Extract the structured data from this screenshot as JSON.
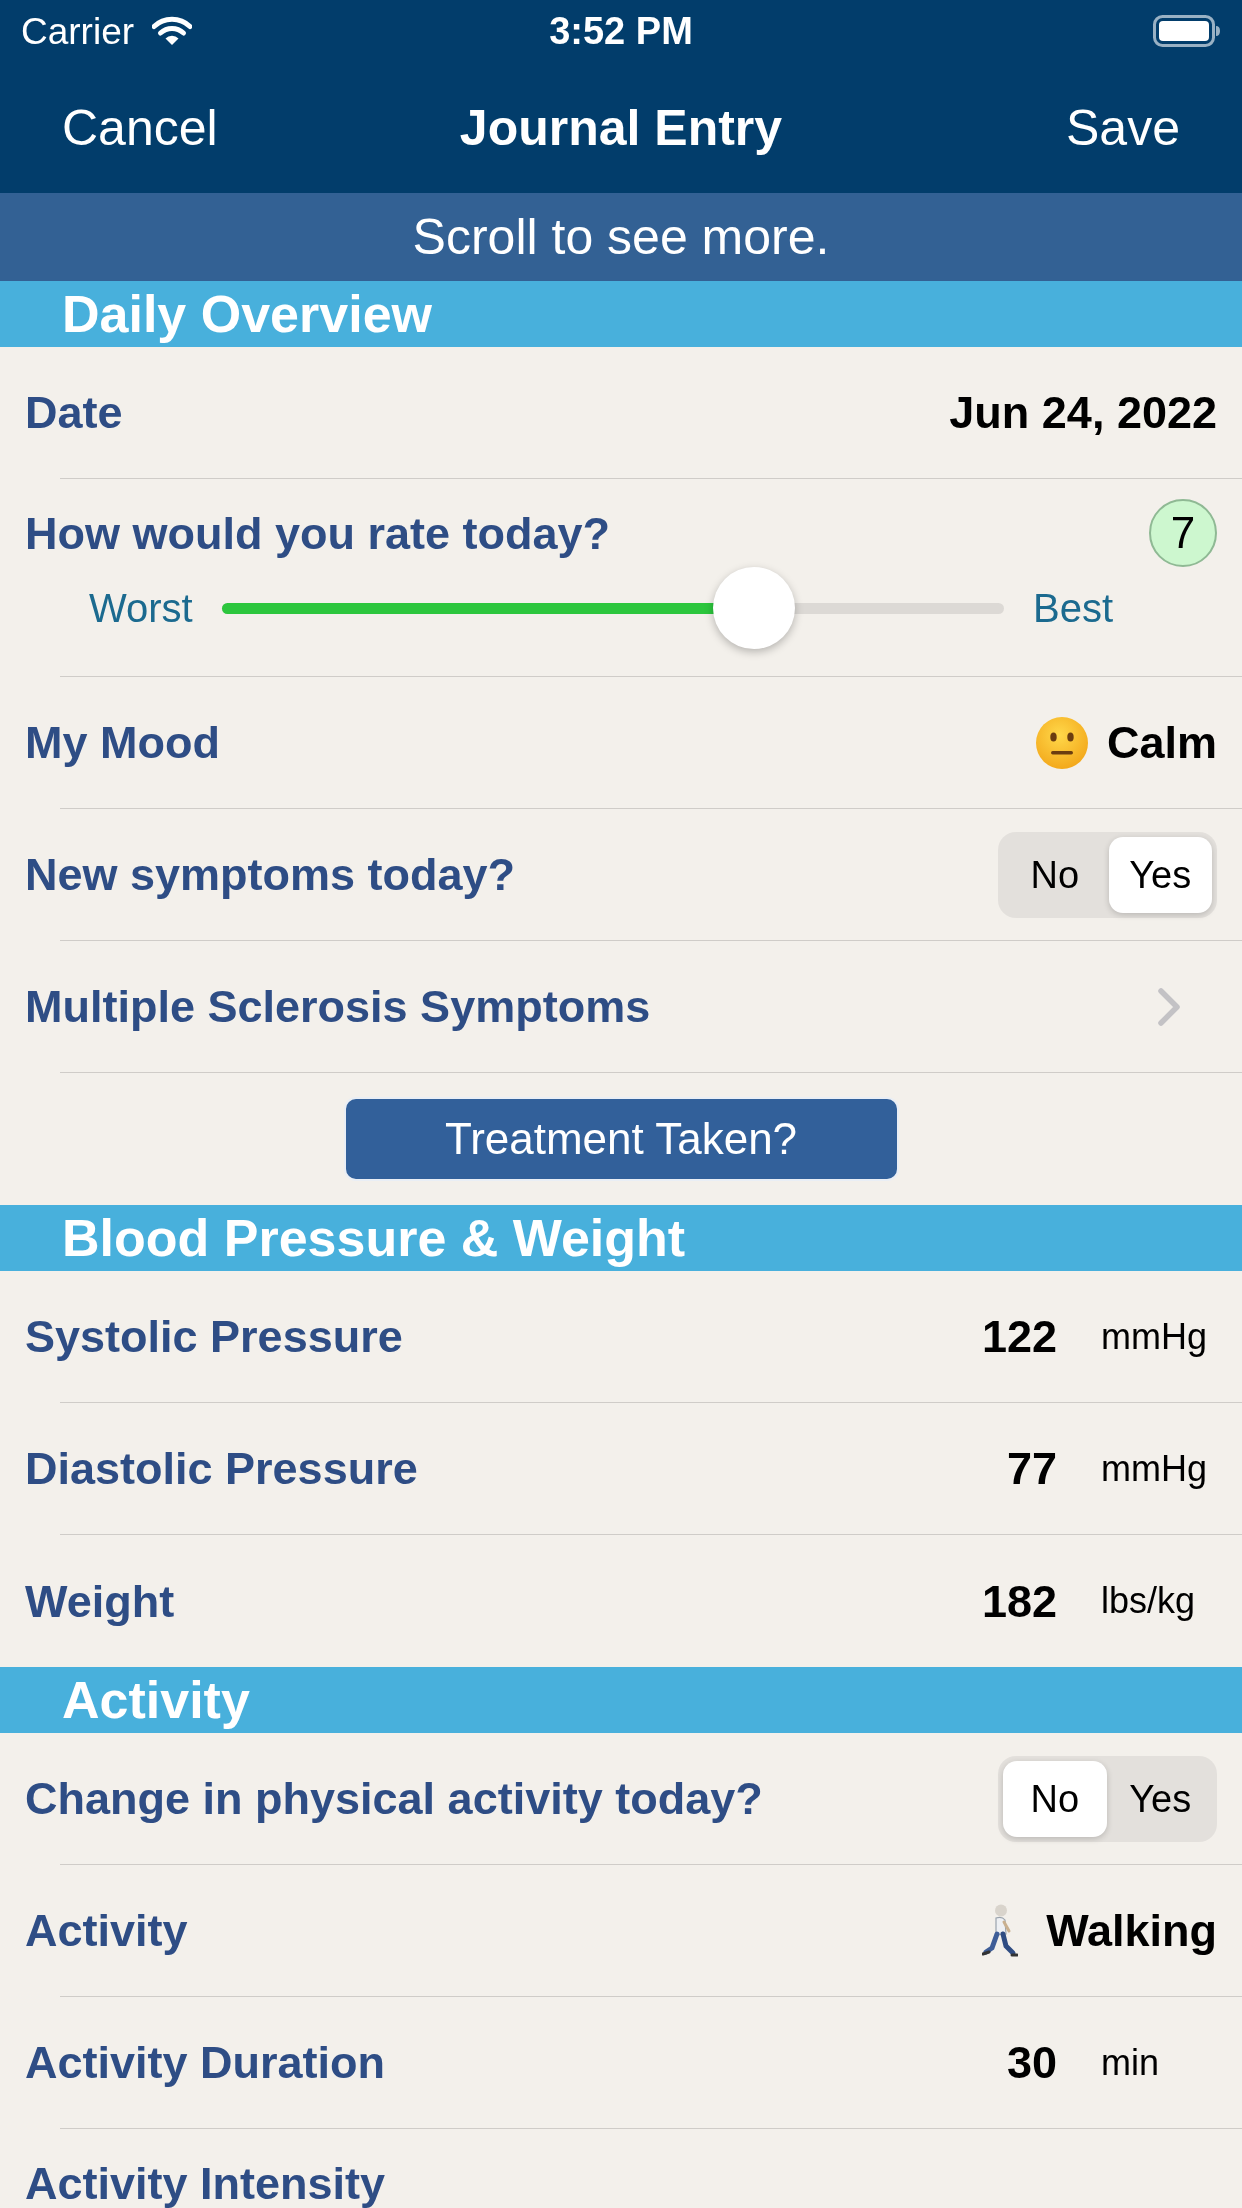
{
  "status_bar": {
    "carrier": "Carrier",
    "time": "3:52 PM"
  },
  "nav_bar": {
    "left_button": "Cancel",
    "title": "Journal Entry",
    "right_button": "Save"
  },
  "banner": "Scroll to see more.",
  "sections": [
    {
      "title": "Daily Overview",
      "rows": [
        {
          "kind": "value",
          "label": "Date",
          "value": "Jun 24, 2022"
        },
        {
          "kind": "rating",
          "label": "How would you rate today?",
          "badge": "7",
          "min_label": "Worst",
          "max_label": "Best",
          "level": 0.68
        },
        {
          "kind": "mood",
          "label": "My Mood",
          "value": "Calm"
        },
        {
          "kind": "segmented",
          "label": "New symptoms today?",
          "options": [
            {
              "label": "No",
              "selected": false
            },
            {
              "label": "Yes",
              "selected": true
            }
          ]
        },
        {
          "kind": "link",
          "label": "Multiple Sclerosis Symptoms"
        },
        {
          "kind": "button",
          "label": "Treatment Taken?"
        }
      ]
    },
    {
      "title": "Blood Pressure & Weight",
      "rows": [
        {
          "kind": "measure",
          "label": "Systolic Pressure",
          "value": "122",
          "unit": "mmHg"
        },
        {
          "kind": "measure",
          "label": "Diastolic Pressure",
          "value": "77",
          "unit": "mmHg"
        },
        {
          "kind": "measure",
          "label": "Weight",
          "value": "182",
          "unit": "lbs/kg"
        }
      ]
    },
    {
      "title": "Activity",
      "rows": [
        {
          "kind": "segmented",
          "label": "Change in physical activity today?",
          "options": [
            {
              "label": "No",
              "selected": true
            },
            {
              "label": "Yes",
              "selected": false
            }
          ]
        },
        {
          "kind": "activity",
          "label": "Activity",
          "value": "Walking"
        },
        {
          "kind": "measure",
          "label": "Activity Duration",
          "value": "30",
          "unit": "min"
        },
        {
          "kind": "heading",
          "label": "Activity Intensity"
        }
      ]
    }
  ]
}
